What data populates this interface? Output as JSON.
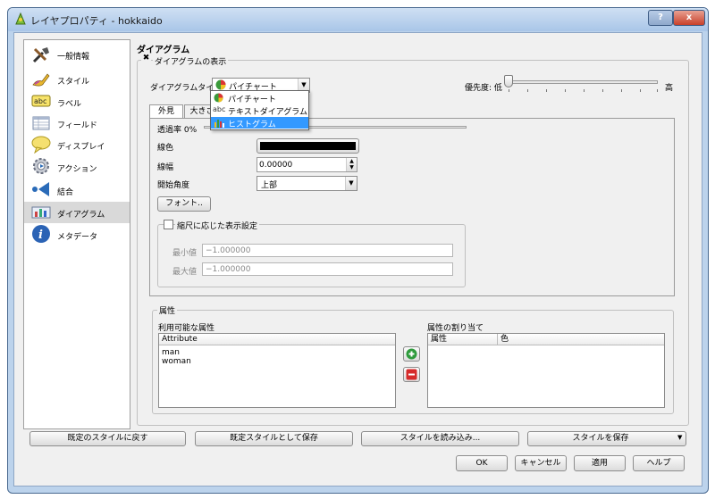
{
  "window": {
    "title": "レイヤプロパティ - hokkaido",
    "help_label": "?",
    "close_label": "x"
  },
  "sidebar": {
    "items": [
      {
        "label": "一般情報",
        "icon": "tools-icon"
      },
      {
        "label": "スタイル",
        "icon": "style-brush-icon"
      },
      {
        "label": "ラベル",
        "icon": "abc-label-icon"
      },
      {
        "label": "フィールド",
        "icon": "table-fields-icon"
      },
      {
        "label": "ディスプレイ",
        "icon": "speech-bubble-icon"
      },
      {
        "label": "アクション",
        "icon": "gear-action-icon"
      },
      {
        "label": "結合",
        "icon": "join-arrow-icon"
      },
      {
        "label": "ダイアグラム",
        "icon": "diagram-icon"
      },
      {
        "label": "メタデータ",
        "icon": "info-icon"
      }
    ],
    "selected_index": 7
  },
  "main": {
    "section_title": "ダイアグラム",
    "show_diagram": {
      "label": "ダイアグラムの表示",
      "checked": true,
      "check_mark": "✖"
    },
    "diagram_type": {
      "label": "ダイアグラムタイプ",
      "selected": "パイチャート",
      "options": [
        {
          "label": "パイチャート",
          "icon": "pie-icon"
        },
        {
          "label": "テキストダイアグラム",
          "icon": "abc-icon",
          "prefix": "abc"
        },
        {
          "label": "ヒストグラム",
          "icon": "histogram-icon",
          "highlighted": true
        }
      ]
    },
    "priority": {
      "label": "優先度: 低",
      "high_label": "高",
      "value": 0
    },
    "tabs": [
      "外見",
      "大きさ"
    ],
    "appearance": {
      "transparency_label": "透過率 0%",
      "line_color_label": "線色",
      "line_color": "#000000",
      "line_width_label": "線幅",
      "line_width_value": "0.00000",
      "start_angle_label": "開始角度",
      "start_angle_value": "上部",
      "font_button": "フォント..",
      "scale_group": {
        "label": "縮尺に応じた表示設定",
        "checked": false,
        "min_label": "最小値",
        "min_value": "1.000000",
        "max_label": "最大値",
        "max_value": "1.000000"
      }
    },
    "attributes": {
      "group_label": "属性",
      "available_label": "利用可能な属性",
      "available_header": "Attribute",
      "available_items": [
        "man",
        "woman"
      ],
      "assigned_label": "属性の割り当て",
      "assigned_headers": [
        "属性",
        "色"
      ],
      "add_icon": "plus-icon",
      "remove_icon": "minus-icon"
    }
  },
  "footer": {
    "restore_default": "既定のスタイルに戻す",
    "save_as_default": "既定スタイルとして保存",
    "load_style": "スタイルを読み込み...",
    "save_style": "スタイルを保存",
    "ok": "OK",
    "cancel": "キャンセル",
    "apply": "適用",
    "help": "ヘルプ"
  },
  "colors": {
    "title_bar": "#bcd3ec",
    "selection": "#3399ff",
    "add_green": "#2e9b3c",
    "remove_red": "#d62b2b"
  }
}
